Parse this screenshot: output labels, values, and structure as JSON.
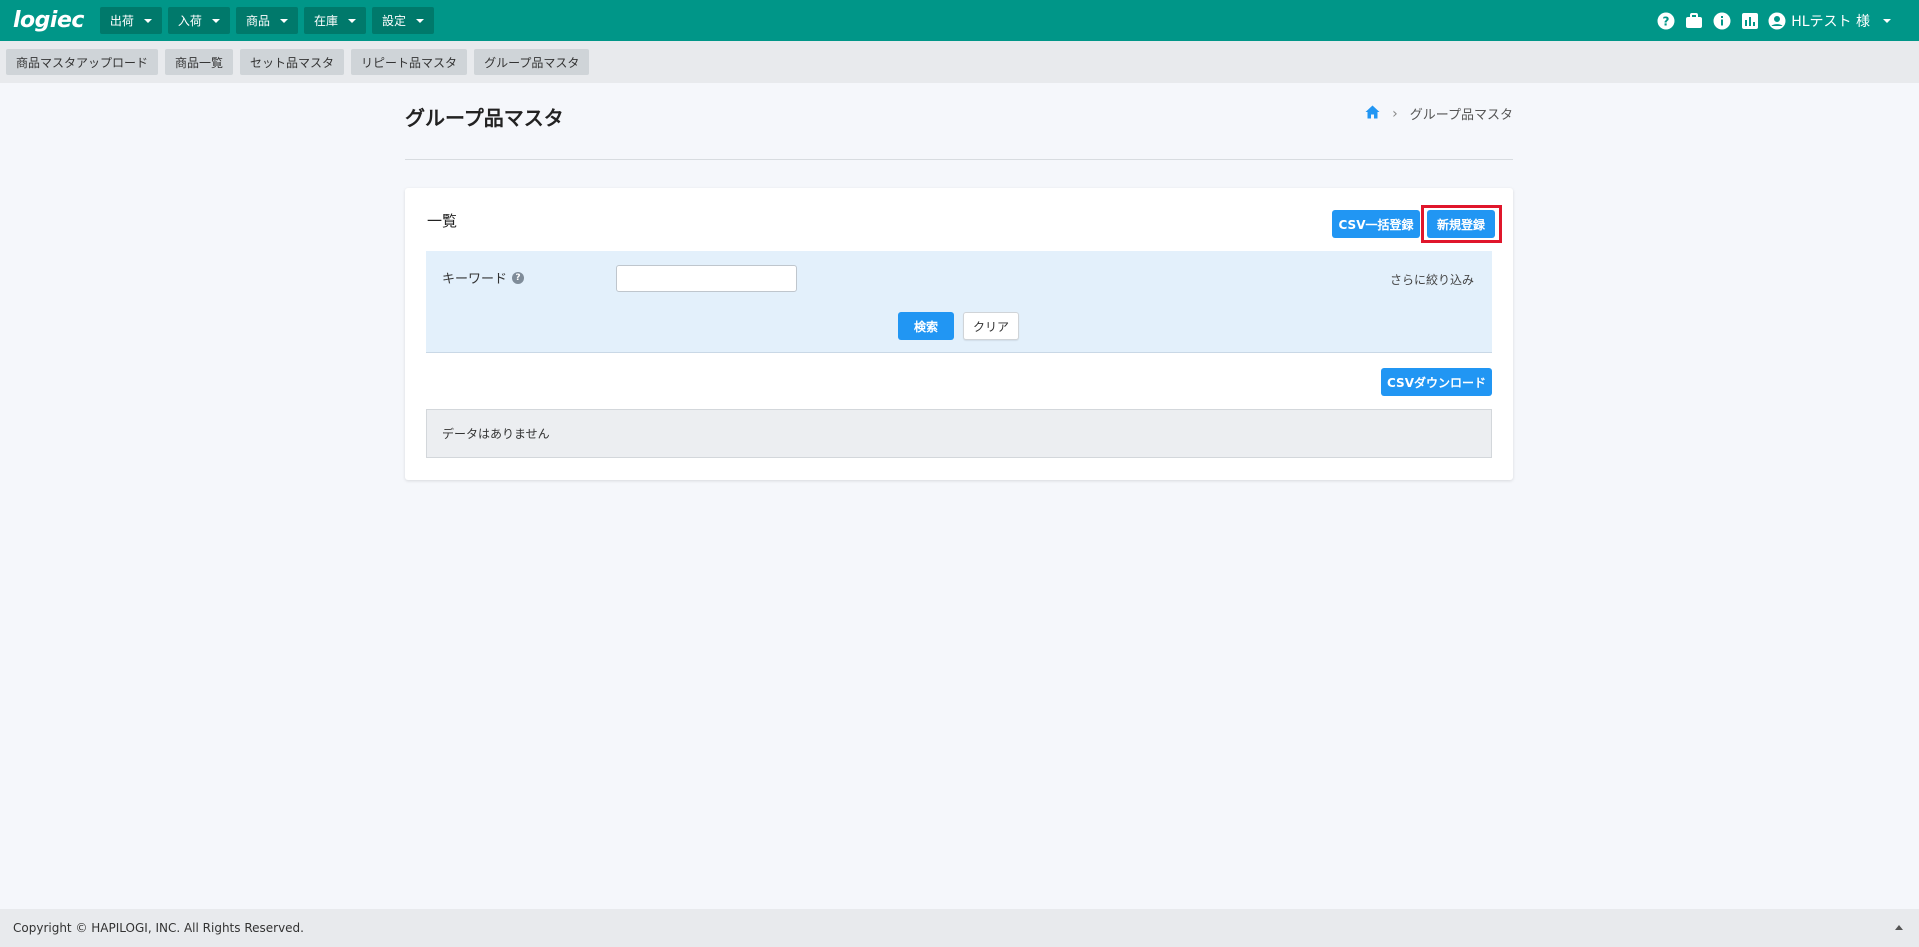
{
  "app": {
    "logo": "logiec"
  },
  "topnav": [
    {
      "label": "出荷"
    },
    {
      "label": "入荷"
    },
    {
      "label": "商品"
    },
    {
      "label": "在庫"
    },
    {
      "label": "設定"
    }
  ],
  "topright": {
    "icons": [
      "help-icon",
      "briefcase-icon",
      "info-icon",
      "bar-chart-icon"
    ],
    "user_label": "HLテスト 様"
  },
  "subnav": [
    {
      "label": "商品マスタアップロード"
    },
    {
      "label": "商品一覧"
    },
    {
      "label": "セット品マスタ"
    },
    {
      "label": "リピート品マスタ"
    },
    {
      "label": "グループ品マスタ"
    }
  ],
  "page": {
    "title": "グループ品マスタ",
    "breadcrumb_current": "グループ品マスタ"
  },
  "card": {
    "title": "一覧",
    "csv_bulk_label": "CSV一括登録",
    "new_label": "新規登録",
    "search": {
      "keyword_label": "キーワード",
      "keyword_value": "",
      "narrow_label": "さらに絞り込み",
      "search_label": "検索",
      "clear_label": "クリア"
    },
    "csv_download_label": "CSVダウンロード",
    "empty_message": "データはありません"
  },
  "footer": {
    "copyright": "Copyright © HAPILOGI, INC. All Rights Reserved."
  },
  "colors": {
    "header": "#009688",
    "accent": "#2196f3",
    "highlight": "#e0162b"
  }
}
